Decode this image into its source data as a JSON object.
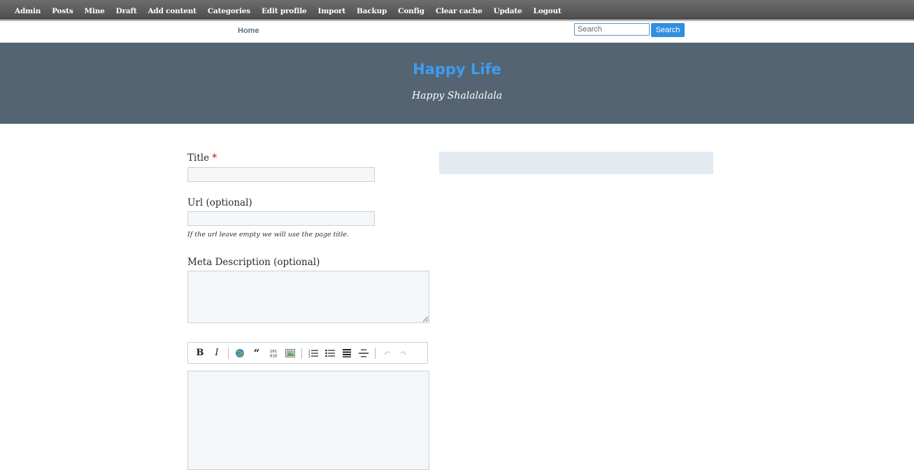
{
  "admin_bar": {
    "items": [
      "Admin",
      "Posts",
      "Mine",
      "Draft",
      "Add content",
      "Categories",
      "Edit profile",
      "Import",
      "Backup",
      "Config",
      "Clear cache",
      "Update",
      "Logout"
    ]
  },
  "nav": {
    "home_label": "Home",
    "search_placeholder": "Search",
    "search_button": "Search"
  },
  "header": {
    "site_title": "Happy Life",
    "tagline": "Happy Shalalalala"
  },
  "form": {
    "title_label": "Title",
    "title_required_mark": "*",
    "title_value": "",
    "url_label": "Url (optional)",
    "url_value": "",
    "url_hint": "If the url leave empty we will use the page title.",
    "meta_label": "Meta Description (optional)",
    "meta_value": "",
    "editor_value": ""
  },
  "toolbar": {
    "buttons": [
      {
        "icon": "bold-icon",
        "glyph": "B"
      },
      {
        "icon": "italic-icon",
        "glyph": "I"
      },
      {
        "icon": "link-icon",
        "glyph": "🔗"
      },
      {
        "icon": "quote-icon",
        "glyph": "❝"
      },
      {
        "icon": "code-icon",
        "glyph": "101"
      },
      {
        "icon": "image-icon",
        "glyph": "▣"
      },
      {
        "icon": "ordered-list-icon",
        "glyph": "1≡"
      },
      {
        "icon": "unordered-list-icon",
        "glyph": "•≡"
      },
      {
        "icon": "heading-icon",
        "glyph": "≣"
      },
      {
        "icon": "horizontal-rule-icon",
        "glyph": "—"
      },
      {
        "icon": "undo-icon",
        "glyph": "↶"
      },
      {
        "icon": "redo-icon",
        "glyph": "↷"
      }
    ]
  },
  "colors": {
    "admin_bar": "#5c5c5c",
    "header_bg": "#556472",
    "site_title": "#3b9df2",
    "search_button": "#2f8fe0",
    "sidebar_box": "#e3eaf1"
  }
}
